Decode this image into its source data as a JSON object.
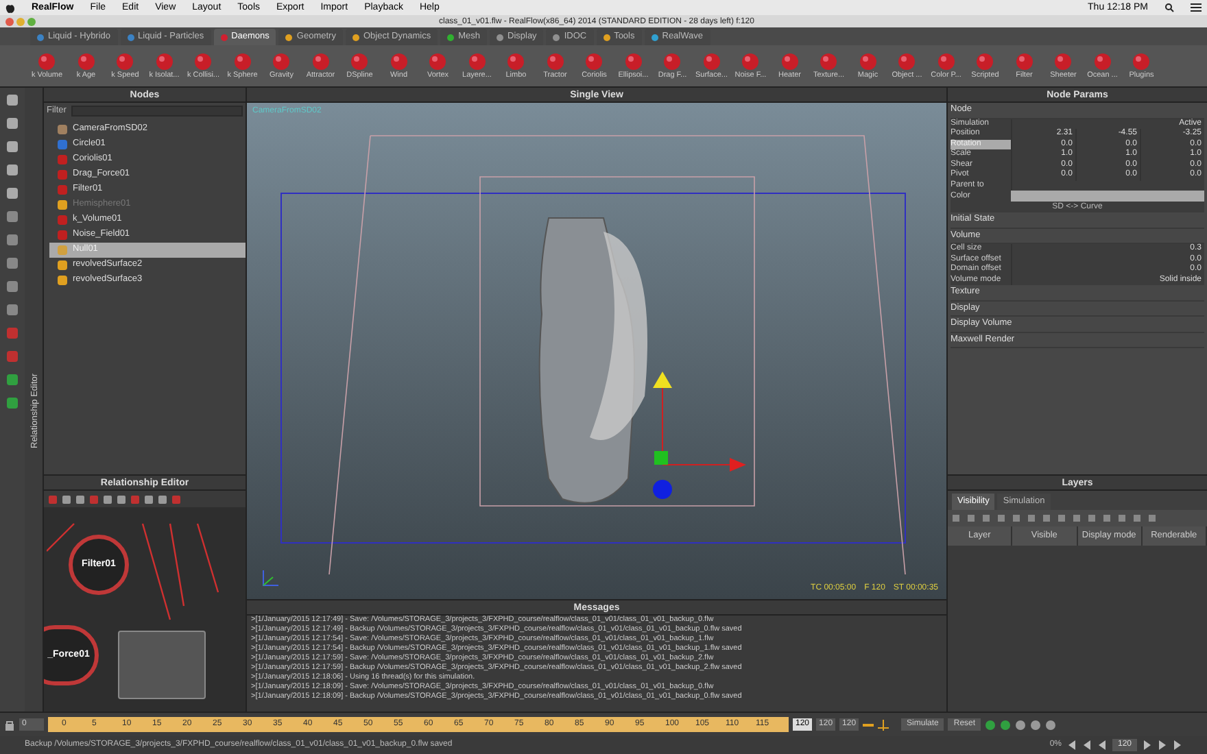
{
  "menubar": {
    "app": "RealFlow",
    "items": [
      "File",
      "Edit",
      "View",
      "Layout",
      "Tools",
      "Export",
      "Import",
      "Playback",
      "Help"
    ],
    "clock": "Thu 12:18 PM"
  },
  "window": {
    "title": "class_01_v01.flw - RealFlow(x86_64) 2014 (STANDARD EDITION - 28 days left) f:120"
  },
  "shelf_tabs": [
    {
      "label": "Liquid - Hybrido",
      "selected": false,
      "color": "#3b82c4"
    },
    {
      "label": "Liquid - Particles",
      "selected": false,
      "color": "#3b82c4"
    },
    {
      "label": "Daemons",
      "selected": true,
      "color": "#d02030"
    },
    {
      "label": "Geometry",
      "selected": false,
      "color": "#e0a020"
    },
    {
      "label": "Object Dynamics",
      "selected": false,
      "color": "#e0a020"
    },
    {
      "label": "Mesh",
      "selected": false,
      "color": "#30b030"
    },
    {
      "label": "Display",
      "selected": false,
      "color": "#909090"
    },
    {
      "label": "IDOC",
      "selected": false,
      "color": "#909090"
    },
    {
      "label": "Tools",
      "selected": false,
      "color": "#e0a020"
    },
    {
      "label": "RealWave",
      "selected": false,
      "color": "#30a0d0"
    }
  ],
  "tools": [
    "k Volume",
    "k Age",
    "k Speed",
    "k Isolat...",
    "k Collisi...",
    "k Sphere",
    "Gravity",
    "Attractor",
    "DSpline",
    "Wind",
    "Vortex",
    "Layere...",
    "Limbo",
    "Tractor",
    "Coriolis",
    "Ellipsoi...",
    "Drag F...",
    "Surface...",
    "Noise F...",
    "Heater",
    "Texture...",
    "Magic",
    "Object ...",
    "Color P...",
    "Scripted",
    "Filter",
    "Sheeter",
    "Ocean ...",
    "Plugins"
  ],
  "nodes": {
    "title": "Nodes",
    "filter_label": "Filter",
    "items": [
      {
        "label": "CameraFromSD02",
        "selected": false,
        "disabled": false,
        "color": "#a08060"
      },
      {
        "label": "Circle01",
        "selected": false,
        "disabled": false,
        "color": "#3070d0"
      },
      {
        "label": "Coriolis01",
        "selected": false,
        "disabled": false,
        "color": "#c02020"
      },
      {
        "label": "Drag_Force01",
        "selected": false,
        "disabled": false,
        "color": "#c02020"
      },
      {
        "label": "Filter01",
        "selected": false,
        "disabled": false,
        "color": "#c02020"
      },
      {
        "label": "Hemisphere01",
        "selected": false,
        "disabled": true,
        "color": "#e0a020"
      },
      {
        "label": "k_Volume01",
        "selected": false,
        "disabled": false,
        "color": "#c02020"
      },
      {
        "label": "Noise_Field01",
        "selected": false,
        "disabled": false,
        "color": "#c02020"
      },
      {
        "label": "Null01",
        "selected": true,
        "disabled": false,
        "color": "#d0a040"
      },
      {
        "label": "revolvedSurface2",
        "selected": false,
        "disabled": false,
        "color": "#e0a020"
      },
      {
        "label": "revolvedSurface3",
        "selected": false,
        "disabled": false,
        "color": "#e0a020"
      }
    ]
  },
  "side_tab": "Relationship Editor",
  "relationship_editor": {
    "title": "Relationship Editor",
    "nodes": [
      "Filter01",
      "_Force01"
    ]
  },
  "viewport": {
    "title": "Single View",
    "camera_label": "CameraFromSD02",
    "readout": [
      "TC 00:05:00",
      "F 120",
      "ST 00:00:35"
    ]
  },
  "messages": {
    "title": "Messages",
    "lines": [
      ">[1/January/2015 12:17:49] - Save: /Volumes/STORAGE_3/projects_3/FXPHD_course/realflow/class_01_v01/class_01_v01_backup_0.flw",
      ">[1/January/2015 12:17:49] - Backup /Volumes/STORAGE_3/projects_3/FXPHD_course/realflow/class_01_v01/class_01_v01_backup_0.flw saved",
      ">[1/January/2015 12:17:54] - Save: /Volumes/STORAGE_3/projects_3/FXPHD_course/realflow/class_01_v01/class_01_v01_backup_1.flw",
      ">[1/January/2015 12:17:54] - Backup /Volumes/STORAGE_3/projects_3/FXPHD_course/realflow/class_01_v01/class_01_v01_backup_1.flw saved",
      ">[1/January/2015 12:17:59] - Save: /Volumes/STORAGE_3/projects_3/FXPHD_course/realflow/class_01_v01/class_01_v01_backup_2.flw",
      ">[1/January/2015 12:17:59] - Backup /Volumes/STORAGE_3/projects_3/FXPHD_course/realflow/class_01_v01/class_01_v01_backup_2.flw saved",
      ">[1/January/2015 12:18:06] - Using 16 thread(s) for this simulation.",
      ">[1/January/2015 12:18:09] - Save: /Volumes/STORAGE_3/projects_3/FXPHD_course/realflow/class_01_v01/class_01_v01_backup_0.flw",
      ">[1/January/2015 12:18:09] - Backup /Volumes/STORAGE_3/projects_3/FXPHD_course/realflow/class_01_v01/class_01_v01_backup_0.flw saved"
    ]
  },
  "node_params": {
    "title": "Node Params",
    "rows": [
      {
        "kind": "header",
        "label": "Node"
      },
      {
        "kind": "field",
        "label": "Simulation",
        "value": "Active"
      },
      {
        "kind": "vector",
        "label": "Position",
        "values": [
          "2.31",
          "-4.55",
          "-3.25"
        ],
        "selected": false
      },
      {
        "kind": "vector",
        "label": "Rotation",
        "values": [
          "0.0",
          "0.0",
          "0.0"
        ],
        "selected": true
      },
      {
        "kind": "vector",
        "label": "Scale",
        "values": [
          "1.0",
          "1.0",
          "1.0"
        ],
        "selected": false
      },
      {
        "kind": "vector",
        "label": "Shear",
        "values": [
          "0.0",
          "0.0",
          "0.0"
        ],
        "selected": false
      },
      {
        "kind": "vector",
        "label": "Pivot",
        "values": [
          "0.0",
          "0.0",
          "0.0"
        ],
        "selected": false
      },
      {
        "kind": "field",
        "label": "Parent to",
        "value": ""
      },
      {
        "kind": "color",
        "label": "Color"
      },
      {
        "kind": "button",
        "label": "SD <-> Curve"
      },
      {
        "kind": "header",
        "label": "Initial State"
      },
      {
        "kind": "header",
        "label": "Volume"
      },
      {
        "kind": "field",
        "label": "Cell size",
        "value": "0.3"
      },
      {
        "kind": "field",
        "label": "Surface offset",
        "value": "0.0"
      },
      {
        "kind": "field",
        "label": "Domain offset",
        "value": "0.0"
      },
      {
        "kind": "field",
        "label": "Volume mode",
        "value": "Solid inside"
      },
      {
        "kind": "header",
        "label": "Texture"
      },
      {
        "kind": "header",
        "label": "Display"
      },
      {
        "kind": "header",
        "label": "Display Volume"
      },
      {
        "kind": "header",
        "label": "Maxwell Render"
      }
    ]
  },
  "layers": {
    "title": "Layers",
    "tabs": [
      {
        "label": "Visibility",
        "selected": true
      },
      {
        "label": "Simulation",
        "selected": false
      }
    ],
    "columns": [
      "Layer",
      "Visible",
      "Display mode",
      "Renderable"
    ]
  },
  "timeline": {
    "start_field": "0",
    "ticks": [
      "0",
      "5",
      "10",
      "15",
      "20",
      "25",
      "30",
      "35",
      "40",
      "45",
      "50",
      "55",
      "60",
      "65",
      "70",
      "75",
      "80",
      "85",
      "90",
      "95",
      "100",
      "105",
      "110",
      "115"
    ],
    "end_fields": [
      "120",
      "120",
      "120"
    ],
    "simulate": "Simulate",
    "reset": "Reset"
  },
  "status_bar": {
    "text": "Backup /Volumes/STORAGE_3/projects_3/FXPHD_course/realflow/class_01_v01/class_01_v01_backup_0.flw saved",
    "progress": "0%",
    "frame": "120"
  }
}
